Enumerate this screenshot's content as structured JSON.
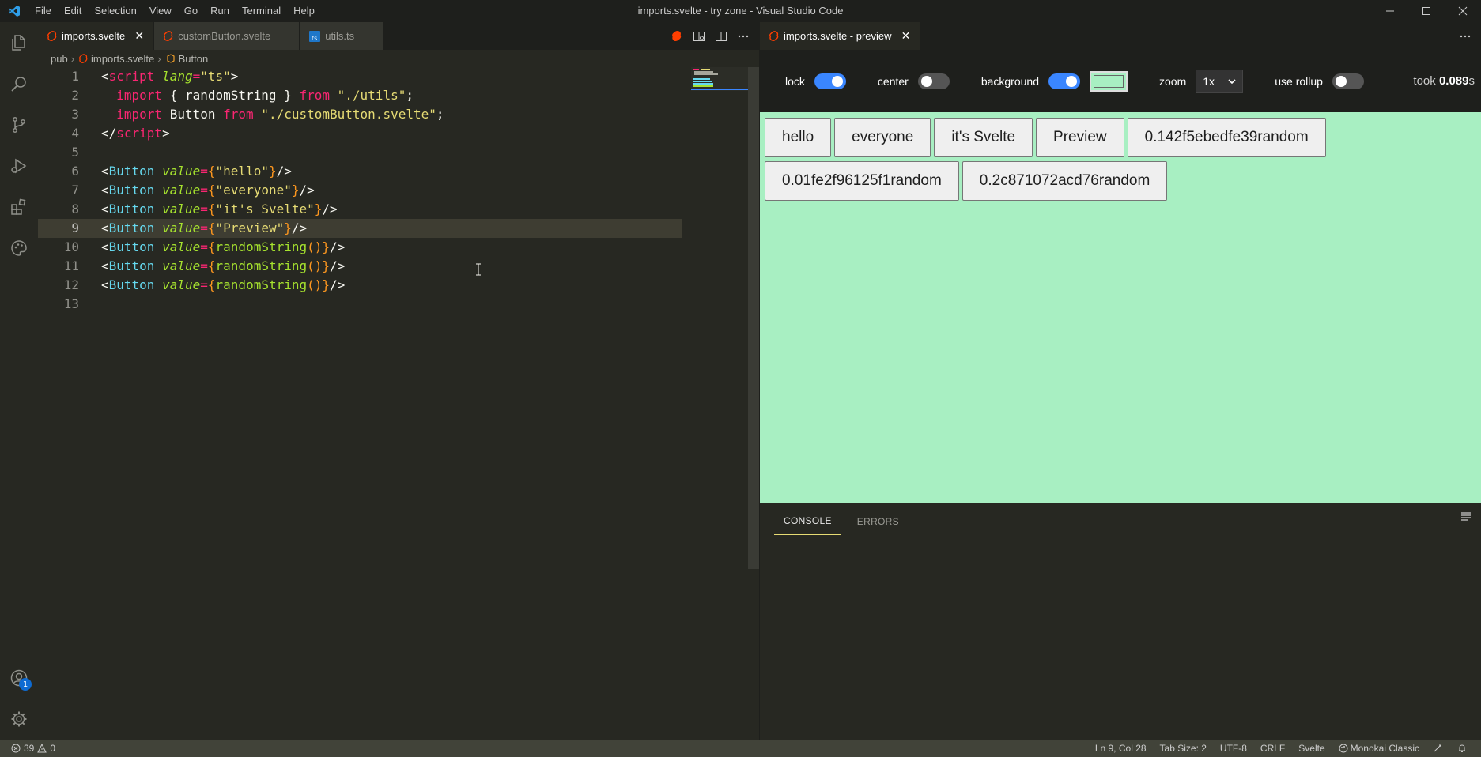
{
  "window": {
    "title": "imports.svelte - try zone - Visual Studio Code",
    "menu": [
      "File",
      "Edit",
      "Selection",
      "View",
      "Go",
      "Run",
      "Terminal",
      "Help"
    ]
  },
  "activity": {
    "icons": [
      "files-icon",
      "search-icon",
      "source-control-icon",
      "run-debug-icon",
      "extensions-icon",
      "palette-icon"
    ],
    "accounts_badge": "1"
  },
  "editor": {
    "tabs": [
      {
        "label": "imports.svelte",
        "icon": "svelte-icon",
        "active": true
      },
      {
        "label": "customButton.svelte",
        "icon": "svelte-icon",
        "active": false
      },
      {
        "label": "utils.ts",
        "icon": "typescript-icon",
        "active": false
      }
    ],
    "breadcrumb": {
      "folder": "pub",
      "file": "imports.svelte",
      "symbol": "Button"
    },
    "current_line": 9,
    "lines": [
      {
        "n": "1"
      },
      {
        "n": "2"
      },
      {
        "n": "3"
      },
      {
        "n": "4"
      },
      {
        "n": "5"
      },
      {
        "n": "6"
      },
      {
        "n": "7"
      },
      {
        "n": "8"
      },
      {
        "n": "9"
      },
      {
        "n": "10"
      },
      {
        "n": "11"
      },
      {
        "n": "12"
      },
      {
        "n": "13"
      }
    ],
    "code": {
      "script_open_tag": "script",
      "lang_attr": "lang",
      "lang_value": "\"ts\"",
      "import_kw": "import",
      "from_kw": "from",
      "import1_names": "{ randomString }",
      "import1_path": "\"./utils\"",
      "import2_name": "Button",
      "import2_path": "\"./customButton.svelte\"",
      "script_close_tag": "script",
      "component": "Button",
      "value_attr": "value",
      "str_hello": "\"hello\"",
      "str_everyone": "\"everyone\"",
      "str_svelte": "\"it's Svelte\"",
      "str_preview": "\"Preview\"",
      "fn_call": "randomString"
    }
  },
  "preview": {
    "tab_label": "imports.svelte - preview",
    "controls": {
      "lock_label": "lock",
      "lock_on": true,
      "center_label": "center",
      "center_on": false,
      "background_label": "background",
      "background_on": true,
      "background_color": "#a8efc2",
      "zoom_label": "zoom",
      "zoom_value": "1x",
      "rollup_label": "use rollup",
      "rollup_on": false,
      "took_prefix": "took",
      "took_value": "0.089",
      "took_unit": "s"
    },
    "buttons": [
      "hello",
      "everyone",
      "it's Svelte",
      "Preview",
      "0.142f5ebedfe39random",
      "0.01fe2f96125f1random",
      "0.2c871072acd76random"
    ],
    "console_tabs": [
      "CONSOLE",
      "ERRORS"
    ]
  },
  "status": {
    "errors": "39",
    "warnings": "0",
    "position": "Ln 9, Col 28",
    "tab_size": "Tab Size: 2",
    "encoding": "UTF-8",
    "eol": "CRLF",
    "language": "Svelte",
    "theme": "Monokai Classic"
  },
  "colors": {
    "editor_bg": "#272822",
    "accent_blue": "#3a86ff",
    "preview_bg": "#a8efc2",
    "svelte_orange": "#ff3e00"
  }
}
